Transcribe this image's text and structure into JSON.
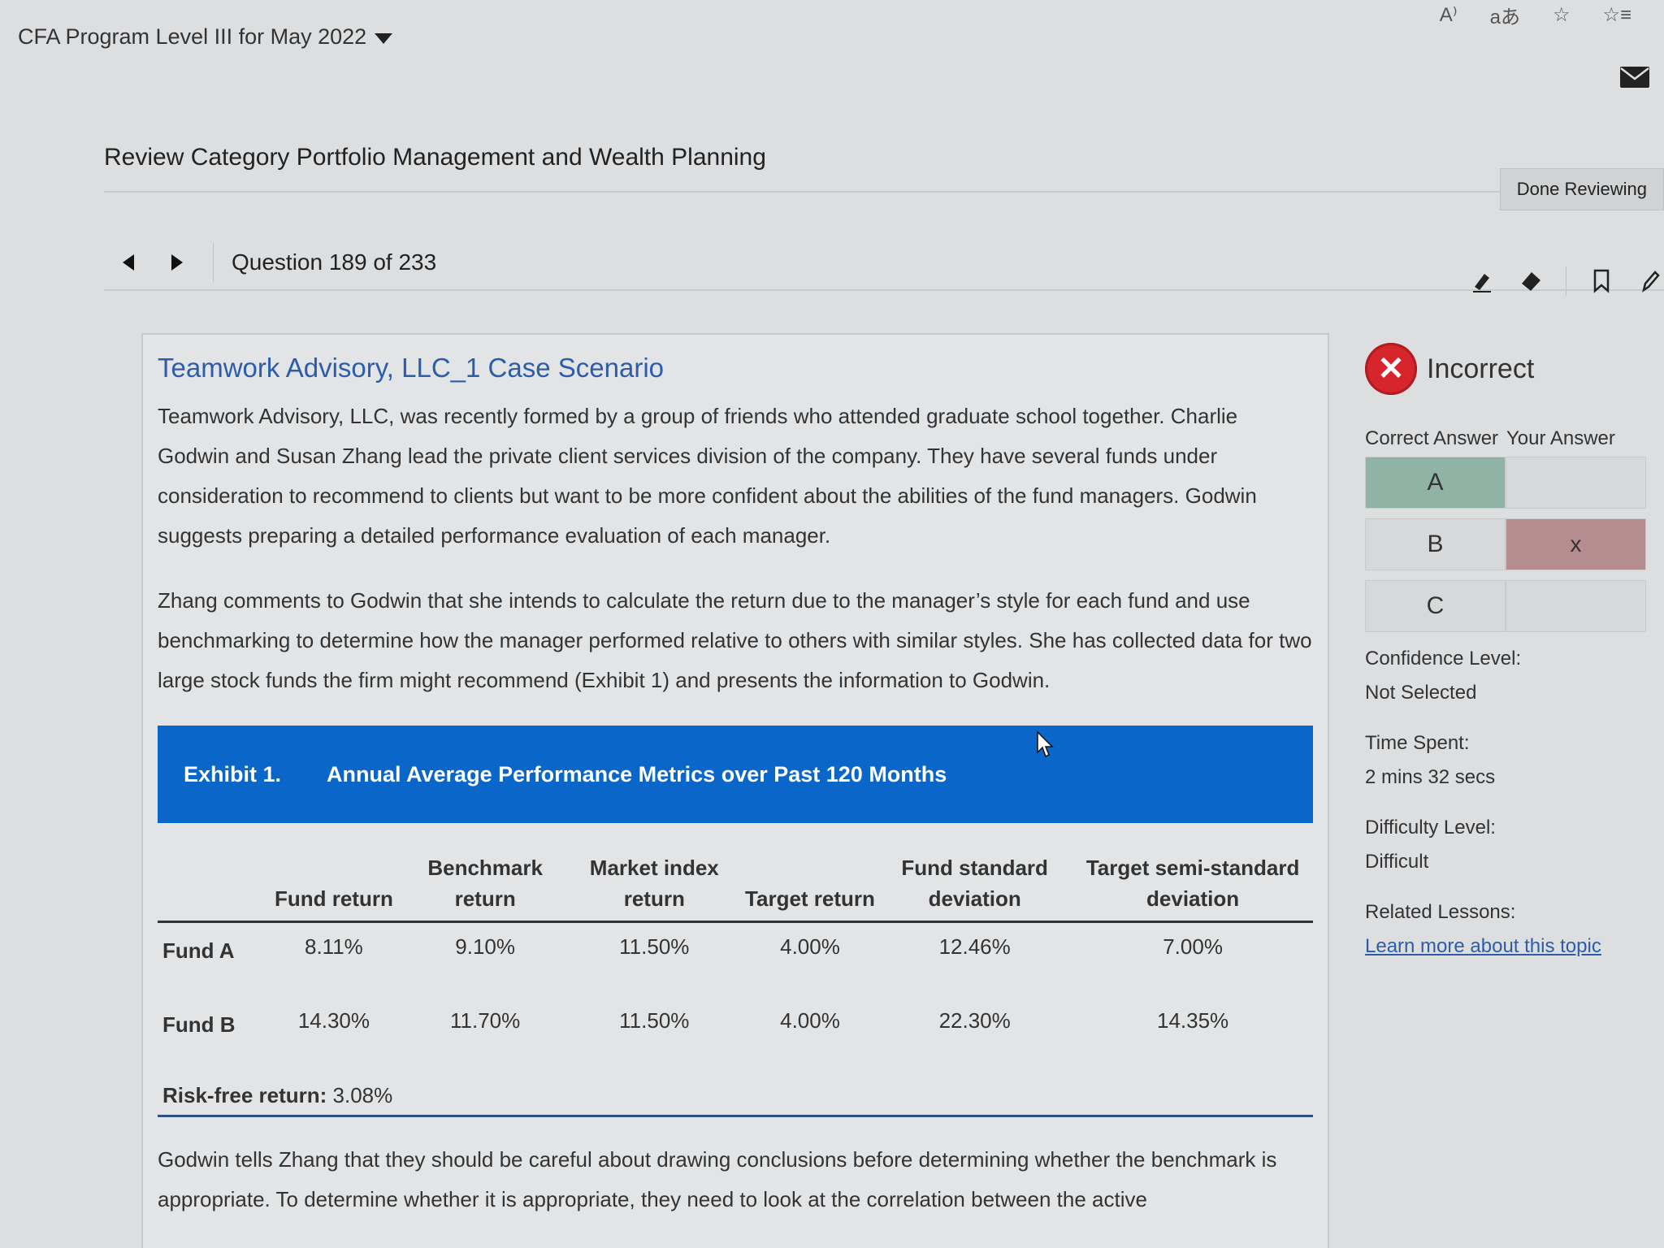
{
  "topbar": {
    "program_title": "CFA Program Level III for May 2022"
  },
  "review": {
    "title": "Review Category Portfolio Management and Wealth Planning",
    "done_label": "Done Reviewing"
  },
  "nav": {
    "question_counter": "Question 189 of 233"
  },
  "icons": {
    "prev": "chevron-left-icon",
    "next": "chevron-right-icon",
    "highlighter": "highlighter-icon",
    "eraser": "eraser-icon",
    "bookmark": "bookmark-icon",
    "pencil": "pencil-icon",
    "mail": "mail-icon"
  },
  "case": {
    "title": "Teamwork Advisory, LLC_1 Case Scenario",
    "para1": "Teamwork Advisory, LLC, was recently formed by a group of friends who attended graduate school together. Charlie Godwin and Susan Zhang lead the private client services division of the company. They have several funds under consideration to recommend to clients but want to be more confident about the abilities of the fund managers. Godwin suggests preparing a detailed performance evaluation of each manager.",
    "para2": "Zhang comments to Godwin that she intends to calculate the return due to the manager’s style for each fund and use benchmarking to determine how the manager performed relative to others with similar styles. She has collected data for two large stock funds the firm might recommend (Exhibit 1) and presents the information to Godwin.",
    "exhibit": {
      "number": "Exhibit 1.",
      "title": "Annual Average Performance Metrics over Past 120 Months",
      "columns": [
        "",
        "Fund return",
        "Benchmark return",
        "Market index return",
        "Target return",
        "Fund standard deviation",
        "Target semi-standard deviation"
      ],
      "rows": [
        {
          "label": "Fund A",
          "values": [
            "8.11%",
            "9.10%",
            "11.50%",
            "4.00%",
            "12.46%",
            "7.00%"
          ]
        },
        {
          "label": "Fund B",
          "values": [
            "14.30%",
            "11.70%",
            "11.50%",
            "4.00%",
            "22.30%",
            "14.35%"
          ]
        }
      ],
      "risk_free_label": "Risk-free return:",
      "risk_free_value": "3.08%"
    },
    "para3": "Godwin tells Zhang that they should be careful about drawing conclusions before determining whether the benchmark is appropriate. To determine whether it is appropriate, they need to look at the correlation between the active"
  },
  "result": {
    "status": "Incorrect",
    "correct_answer_label": "Correct Answer",
    "your_answer_label": "Your Answer",
    "options": [
      {
        "letter": "A",
        "mark": ""
      },
      {
        "letter": "B",
        "mark": "x"
      },
      {
        "letter": "C",
        "mark": ""
      }
    ],
    "confidence_label": "Confidence Level:",
    "confidence_value": "Not Selected",
    "time_label": "Time Spent:",
    "time_value": "2 mins 32 secs",
    "difficulty_label": "Difficulty Level:",
    "difficulty_value": "Difficult",
    "lessons_label": "Related Lessons:",
    "lessons_link": "Learn more about this topic"
  },
  "colors": {
    "accent": "#0a66c8",
    "title_blue": "#2d5da8",
    "incorrect_red": "#d7262b",
    "correct_green": "#8fb3a5",
    "wrong_red": "#b58d8f"
  }
}
